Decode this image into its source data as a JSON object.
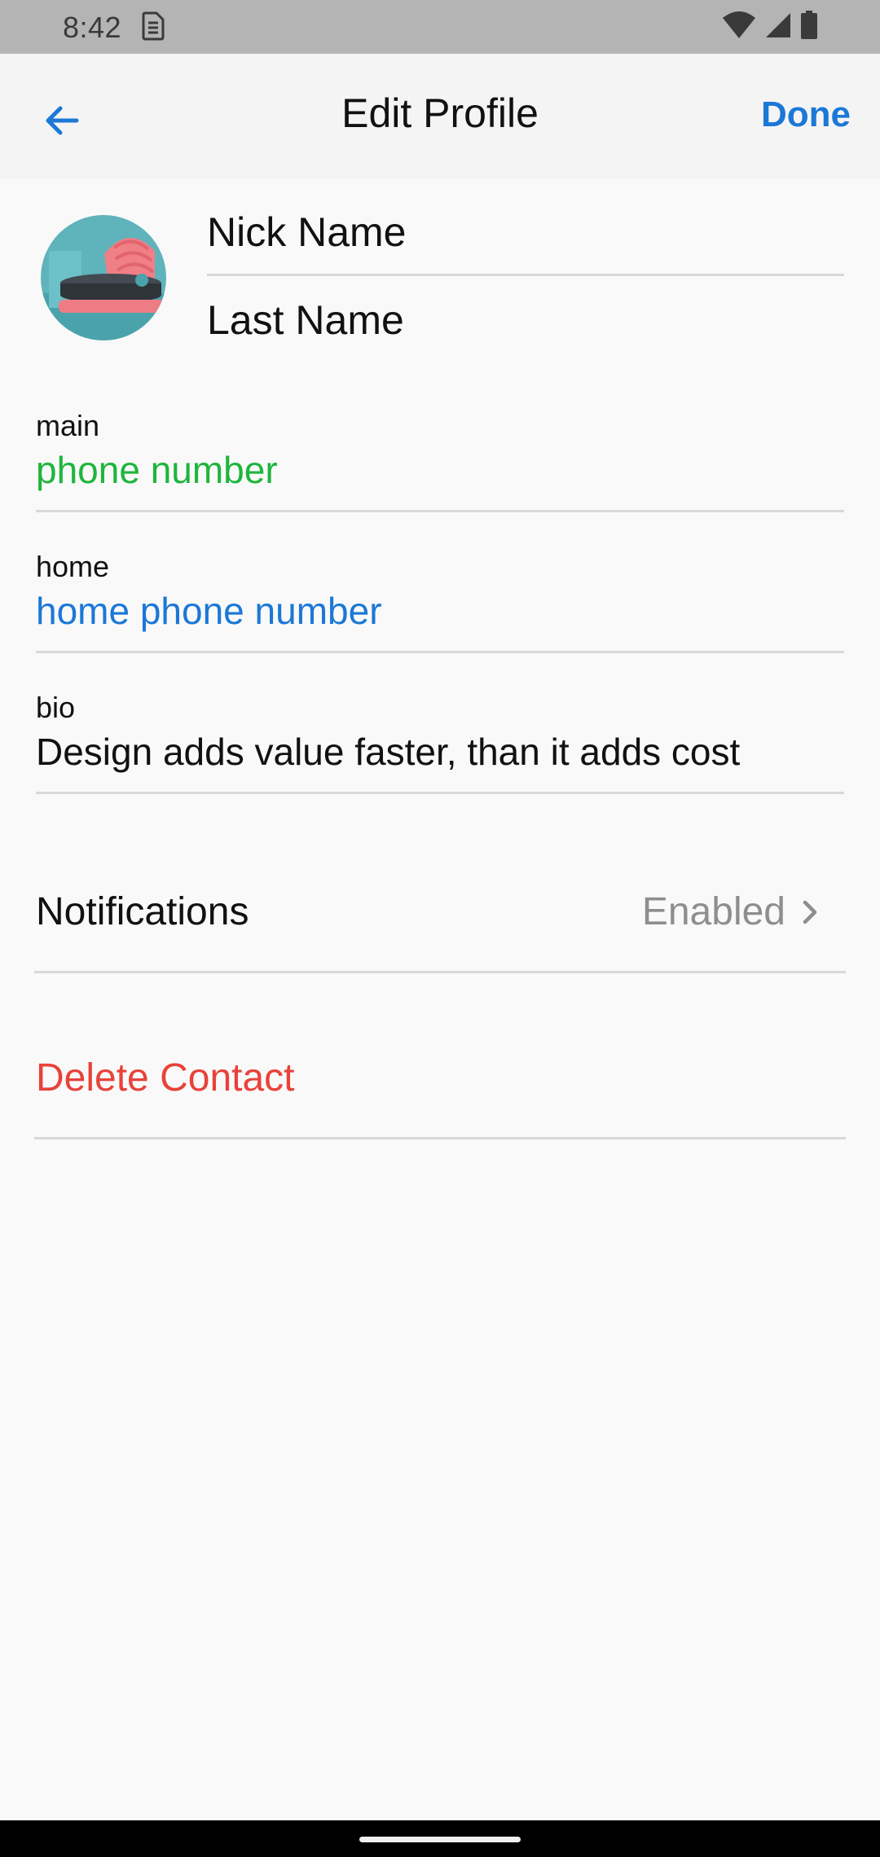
{
  "status_bar": {
    "time": "8:42",
    "sim_icon": "sim-card-icon",
    "wifi_icon": "wifi-icon",
    "signal_icon": "cellular-signal-icon",
    "battery_icon": "battery-icon"
  },
  "app_bar": {
    "back_icon": "arrow-left-icon",
    "title": "Edit Profile",
    "done_label": "Done"
  },
  "profile": {
    "avatar_icon": "avatar-image",
    "nick_name_placeholder": "Nick Name",
    "last_name_placeholder": "Last Name"
  },
  "fields": {
    "main": {
      "label": "main",
      "value": "phone number"
    },
    "home": {
      "label": "home",
      "value": "home phone number"
    },
    "bio": {
      "label": "bio",
      "value": "Design adds value faster, than it adds cost"
    }
  },
  "notifications": {
    "label": "Notifications",
    "value": "Enabled",
    "chevron_icon": "chevron-right-icon"
  },
  "delete": {
    "label": "Delete Contact"
  },
  "colors": {
    "accent": "#1b78d6",
    "main_value": "#1fb53c",
    "home_value": "#1b78d6",
    "danger": "#e8423a",
    "muted": "#8e8e8e"
  }
}
